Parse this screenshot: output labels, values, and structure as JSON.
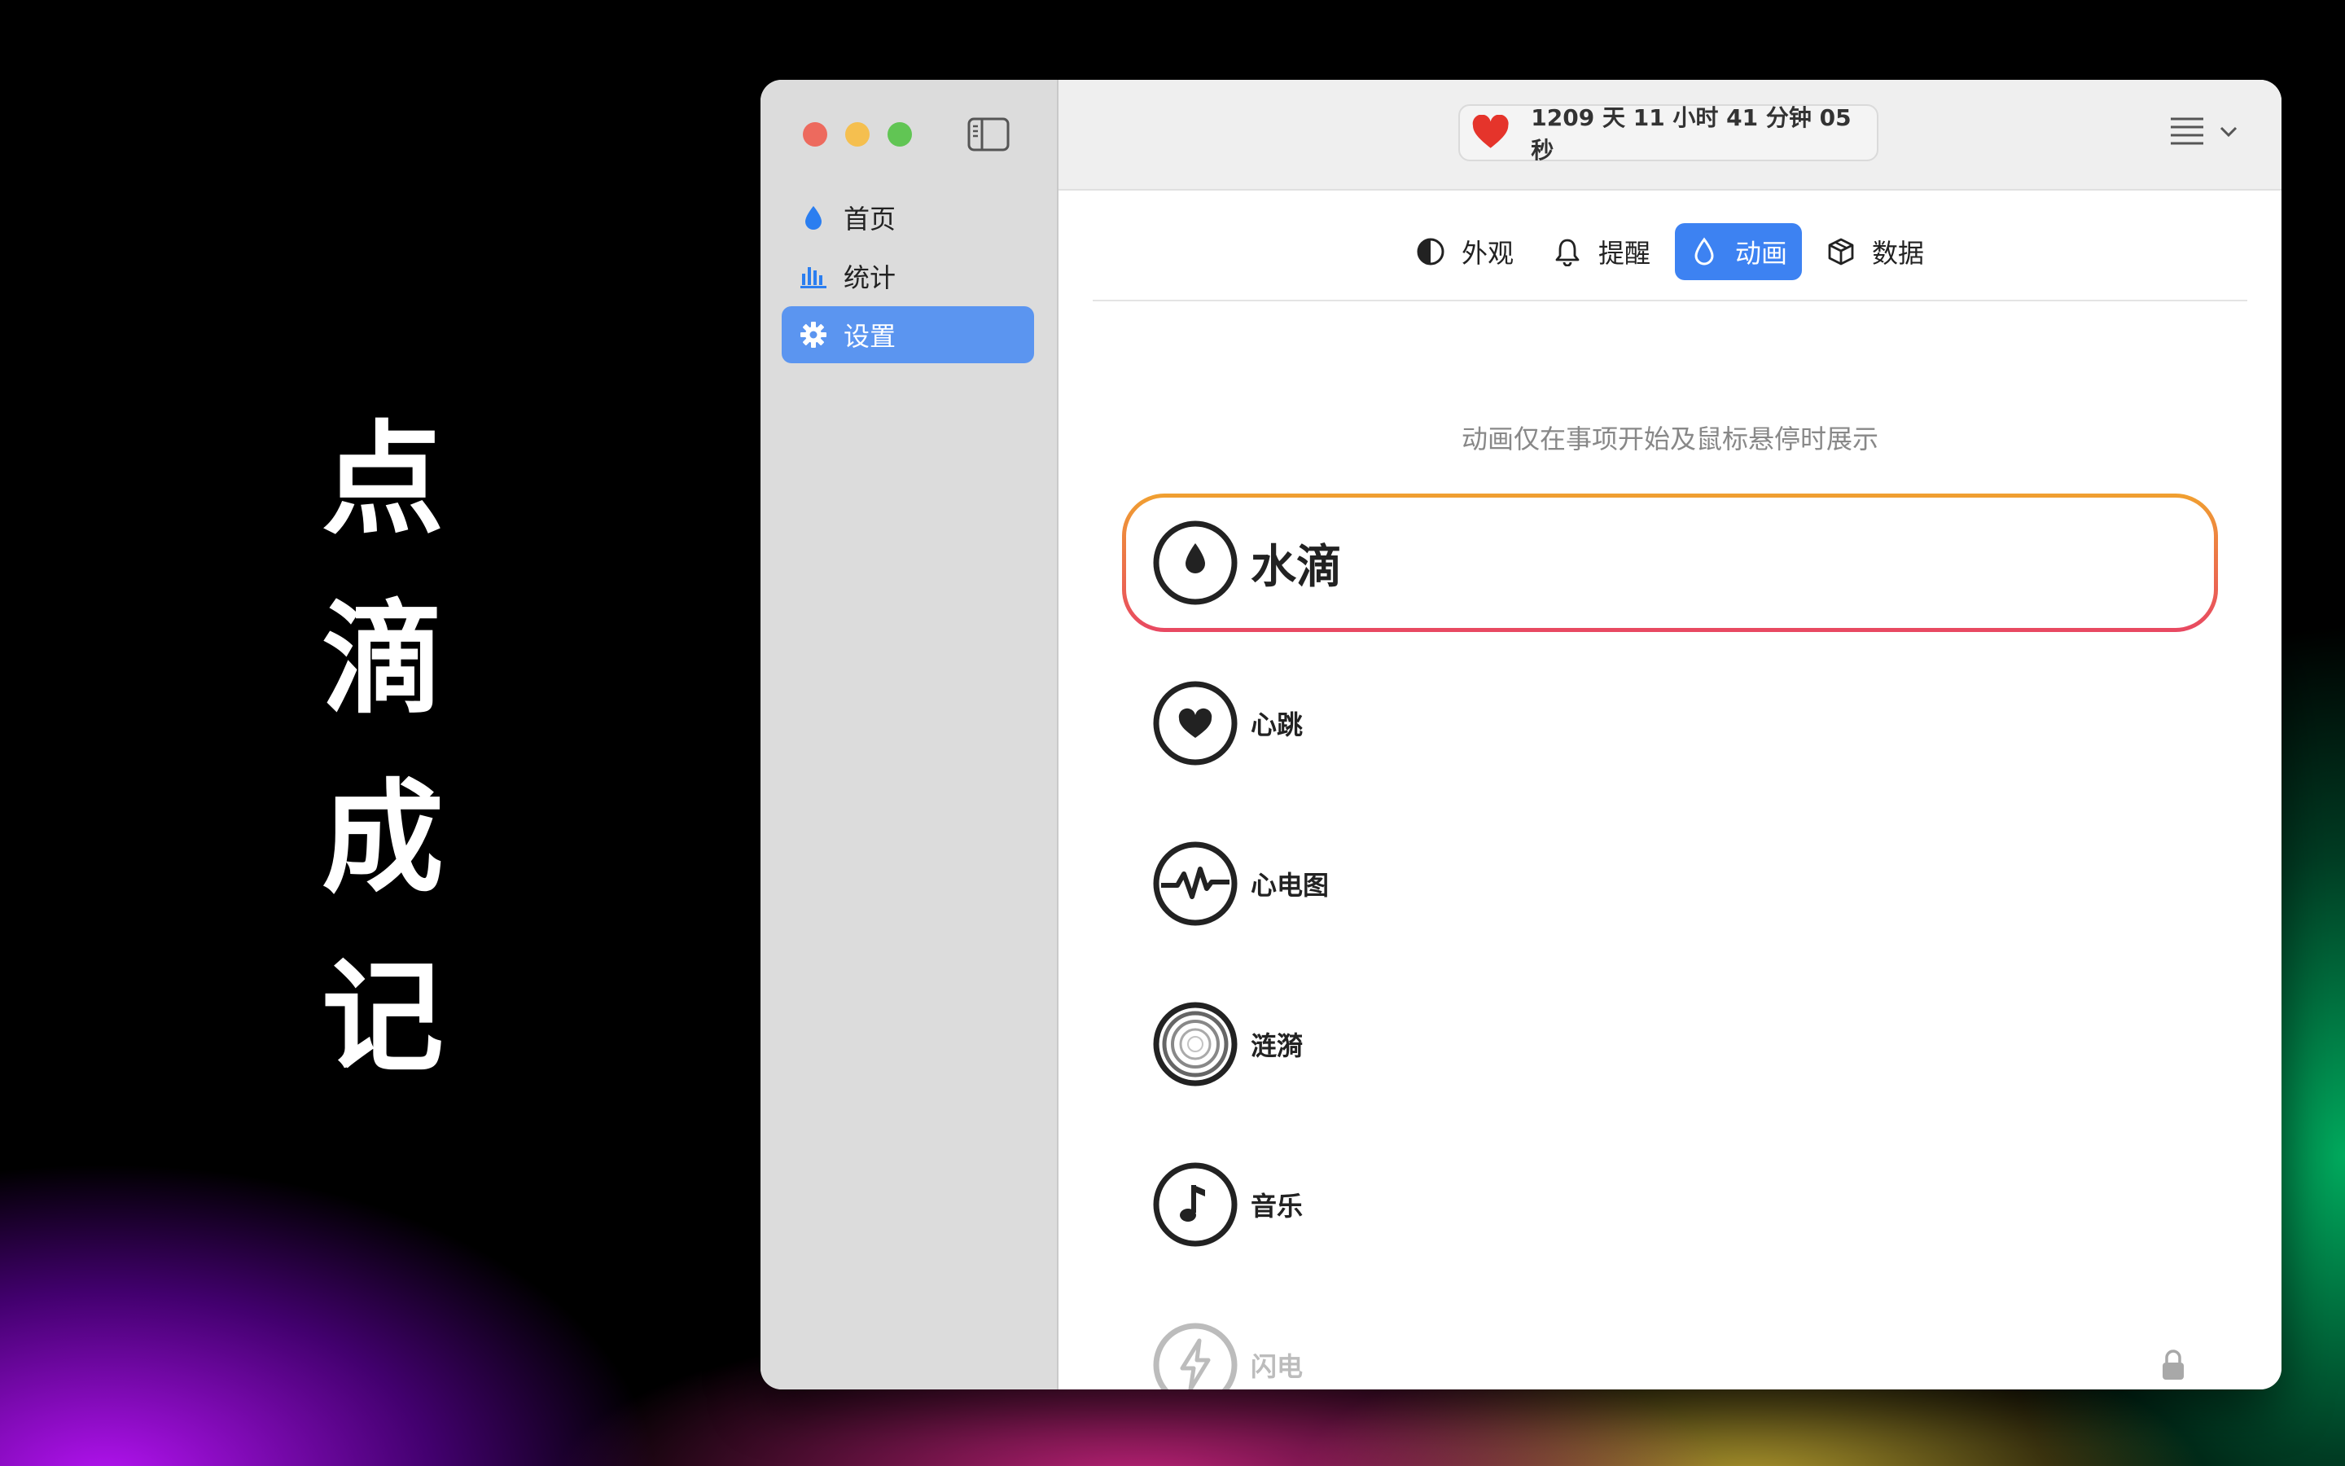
{
  "promo": {
    "chars": [
      "点",
      "滴",
      "成",
      "记"
    ]
  },
  "sidebar": {
    "items": [
      {
        "label": "首页",
        "icon": "drop-icon"
      },
      {
        "label": "统计",
        "icon": "bar-chart-icon"
      },
      {
        "label": "设置",
        "icon": "gear-icon",
        "active": true
      }
    ]
  },
  "header": {
    "timer": "1209 天 11 小时 41 分钟 05 秒",
    "timer_icon": "heart-icon",
    "menu_icon": "list-icon"
  },
  "settings": {
    "tabs": [
      {
        "label": "外观",
        "icon": "half-circle-icon"
      },
      {
        "label": "提醒",
        "icon": "bell-icon"
      },
      {
        "label": "动画",
        "icon": "drop-outline-icon",
        "active": true
      },
      {
        "label": "数据",
        "icon": "cube-icon"
      }
    ],
    "hint": "动画仅在事项开始及鼠标悬停时展示",
    "animations": [
      {
        "label": "水滴",
        "icon": "water-drop-icon",
        "selected": true
      },
      {
        "label": "心跳",
        "icon": "heartbeat-icon"
      },
      {
        "label": "心电图",
        "icon": "ecg-icon"
      },
      {
        "label": "涟漪",
        "icon": "ripple-icon"
      },
      {
        "label": "音乐",
        "icon": "music-note-icon"
      },
      {
        "label": "闪电",
        "icon": "lightning-icon",
        "locked": true
      }
    ]
  },
  "colors": {
    "accent": "#3d82f2",
    "sidebar_active": "#5b95f0",
    "selection_gradient": [
      "#f0a030",
      "#e84862"
    ],
    "heart": "#e5342b"
  }
}
